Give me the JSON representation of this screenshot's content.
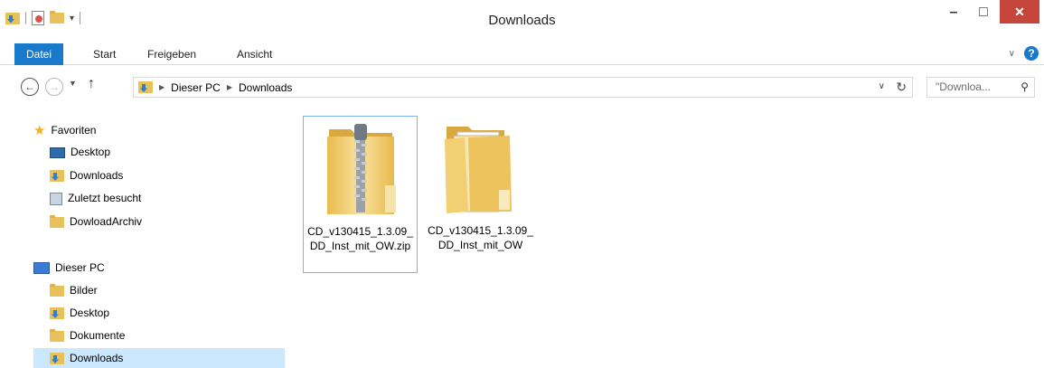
{
  "window": {
    "title": "Downloads",
    "close_symbol": "✕",
    "minimize_symbol": "–",
    "maximize_symbol": "□"
  },
  "ribbon": {
    "tabs": [
      "Datei",
      "Start",
      "Freigeben",
      "Ansicht"
    ],
    "active_tab": "Datei",
    "help": "?"
  },
  "address": {
    "breadcrumbs": [
      "Dieser PC",
      "Downloads"
    ]
  },
  "search": {
    "placeholder": "\"Downloa..."
  },
  "nav": {
    "favorites_label": "Favoriten",
    "favorites": [
      "Desktop",
      "Downloads",
      "Zuletzt besucht",
      "DowloadArchiv"
    ],
    "pc_label": "Dieser PC",
    "pc_items": [
      "Bilder",
      "Desktop",
      "Dokumente",
      "Downloads"
    ]
  },
  "files": [
    {
      "name": "CD_v130415_1.3.09_DD_Inst_mit_OW.zip",
      "type": "zip",
      "selected": true
    },
    {
      "name": "CD_v130415_1.3.09_DD_Inst_mit_OW",
      "type": "folder",
      "selected": false
    }
  ],
  "colors": {
    "accent": "#1979ca",
    "close": "#c7463b",
    "selection": "#cce8ff",
    "folder": "#e9c15b"
  }
}
